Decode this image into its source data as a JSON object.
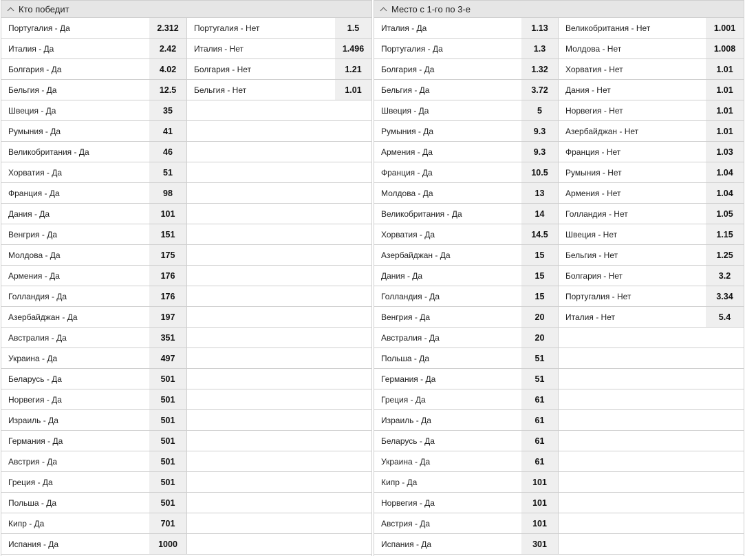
{
  "left": {
    "title": "Кто победит",
    "col1": [
      [
        "Португалия - Да",
        "2.312"
      ],
      [
        "Италия - Да",
        "2.42"
      ],
      [
        "Болгария - Да",
        "4.02"
      ],
      [
        "Бельгия - Да",
        "12.5"
      ],
      [
        "Швеция - Да",
        "35"
      ],
      [
        "Румыния - Да",
        "41"
      ],
      [
        "Великобритания - Да",
        "46"
      ],
      [
        "Хорватия - Да",
        "51"
      ],
      [
        "Франция - Да",
        "98"
      ],
      [
        "Дания - Да",
        "101"
      ],
      [
        "Венгрия - Да",
        "151"
      ],
      [
        "Молдова - Да",
        "175"
      ],
      [
        "Армения - Да",
        "176"
      ],
      [
        "Голландия - Да",
        "176"
      ],
      [
        "Азербайджан - Да",
        "197"
      ],
      [
        "Австралия - Да",
        "351"
      ],
      [
        "Украина - Да",
        "497"
      ],
      [
        "Беларусь - Да",
        "501"
      ],
      [
        "Норвегия - Да",
        "501"
      ],
      [
        "Израиль - Да",
        "501"
      ],
      [
        "Германия - Да",
        "501"
      ],
      [
        "Австрия - Да",
        "501"
      ],
      [
        "Греция - Да",
        "501"
      ],
      [
        "Польша - Да",
        "501"
      ],
      [
        "Кипр - Да",
        "701"
      ],
      [
        "Испания - Да",
        "1000"
      ]
    ],
    "col2": [
      [
        "Португалия - Нет",
        "1.5"
      ],
      [
        "Италия - Нет",
        "1.496"
      ],
      [
        "Болгария - Нет",
        "1.21"
      ],
      [
        "Бельгия - Нет",
        "1.01"
      ]
    ]
  },
  "right": {
    "title": "Место с 1-го по 3-е",
    "col1": [
      [
        "Италия - Да",
        "1.13"
      ],
      [
        "Португалия - Да",
        "1.3"
      ],
      [
        "Болгария - Да",
        "1.32"
      ],
      [
        "Бельгия - Да",
        "3.72"
      ],
      [
        "Швеция - Да",
        "5"
      ],
      [
        "Румыния - Да",
        "9.3"
      ],
      [
        "Армения - Да",
        "9.3"
      ],
      [
        "Франция - Да",
        "10.5"
      ],
      [
        "Молдова - Да",
        "13"
      ],
      [
        "Великобритания - Да",
        "14"
      ],
      [
        "Хорватия - Да",
        "14.5"
      ],
      [
        "Азербайджан - Да",
        "15"
      ],
      [
        "Дания - Да",
        "15"
      ],
      [
        "Голландия - Да",
        "15"
      ],
      [
        "Венгрия - Да",
        "20"
      ],
      [
        "Австралия - Да",
        "20"
      ],
      [
        "Польша - Да",
        "51"
      ],
      [
        "Германия - Да",
        "51"
      ],
      [
        "Греция - Да",
        "61"
      ],
      [
        "Израиль - Да",
        "61"
      ],
      [
        "Беларусь - Да",
        "61"
      ],
      [
        "Украина - Да",
        "61"
      ],
      [
        "Кипр - Да",
        "101"
      ],
      [
        "Норвегия - Да",
        "101"
      ],
      [
        "Австрия - Да",
        "101"
      ],
      [
        "Испания - Да",
        "301"
      ]
    ],
    "col2": [
      [
        "Великобритания - Нет",
        "1.001"
      ],
      [
        "Молдова - Нет",
        "1.008"
      ],
      [
        "Хорватия - Нет",
        "1.01"
      ],
      [
        "Дания - Нет",
        "1.01"
      ],
      [
        "Норвегия - Нет",
        "1.01"
      ],
      [
        "Азербайджан - Нет",
        "1.01"
      ],
      [
        "Франция - Нет",
        "1.03"
      ],
      [
        "Румыния - Нет",
        "1.04"
      ],
      [
        "Армения - Нет",
        "1.04"
      ],
      [
        "Голландия - Нет",
        "1.05"
      ],
      [
        "Швеция - Нет",
        "1.15"
      ],
      [
        "Бельгия - Нет",
        "1.25"
      ],
      [
        "Болгария - Нет",
        "3.2"
      ],
      [
        "Португалия - Нет",
        "3.34"
      ],
      [
        "Италия - Нет",
        "5.4"
      ]
    ]
  },
  "icons": {
    "collapse": "chevron-up-icon"
  },
  "colors": {
    "header_bg": "#e6e6e6",
    "odd_bg": "#efefef",
    "border": "#cfcfcf"
  }
}
